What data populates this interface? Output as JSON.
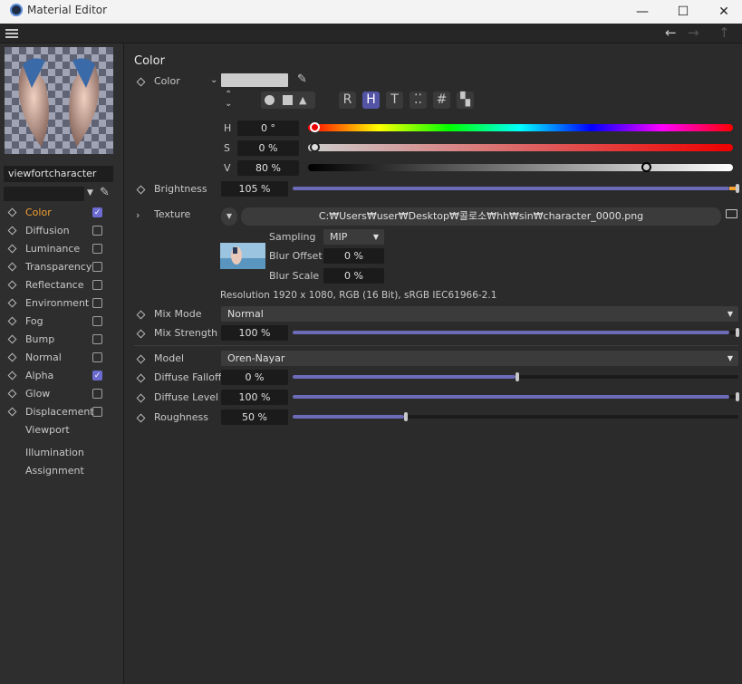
{
  "window": {
    "title": "Material Editor"
  },
  "sidebar": {
    "material_name": "viewfortcharacter",
    "channels": [
      {
        "label": "Color",
        "checked": true,
        "active": true
      },
      {
        "label": "Diffusion",
        "checked": false
      },
      {
        "label": "Luminance",
        "checked": false
      },
      {
        "label": "Transparency",
        "checked": false
      },
      {
        "label": "Reflectance",
        "checked": false
      },
      {
        "label": "Environment",
        "checked": false
      },
      {
        "label": "Fog",
        "checked": false
      },
      {
        "label": "Bump",
        "checked": false
      },
      {
        "label": "Normal",
        "checked": false
      },
      {
        "label": "Alpha",
        "checked": true
      },
      {
        "label": "Glow",
        "checked": false
      },
      {
        "label": "Displacement",
        "checked": false
      }
    ],
    "extra": [
      "Viewport",
      "Illumination",
      "Assignment"
    ]
  },
  "main": {
    "section_title": "Color",
    "color_label": "Color",
    "swatch_color": "#cccccc",
    "mode_buttons": [
      "R",
      "H",
      "T",
      "⁚⁚",
      "#",
      "▚"
    ],
    "h": {
      "label": "H",
      "value": "0 °",
      "fraction": 0.0
    },
    "s": {
      "label": "S",
      "value": "0 %",
      "fraction": 0.0
    },
    "v": {
      "label": "V",
      "value": "80 %",
      "fraction": 0.8
    },
    "brightness": {
      "label": "Brightness",
      "value": "105 %",
      "fraction": 1.0
    },
    "texture": {
      "label": "Texture",
      "path": "C:₩Users₩user₩Desktop₩콜로소₩hh₩sin₩character_0000.png"
    },
    "sampling": {
      "label": "Sampling",
      "value": "MIP"
    },
    "blur_offset": {
      "label": "Blur Offset",
      "value": "0 %"
    },
    "blur_scale": {
      "label": "Blur Scale",
      "value": "0 %"
    },
    "resolution": "Resolution 1920 x 1080, RGB (16 Bit), sRGB IEC61966-2.1",
    "mix_mode": {
      "label": "Mix Mode",
      "value": "Normal"
    },
    "mix_strength": {
      "label": "Mix Strength",
      "value": "100 %",
      "fraction": 1.0
    },
    "model": {
      "label": "Model",
      "value": "Oren-Nayar"
    },
    "diffuse_falloff": {
      "label": "Diffuse Falloff",
      "value": "0 %",
      "fraction": 0.5
    },
    "diffuse_level": {
      "label": "Diffuse Level",
      "value": "100 %",
      "fraction": 1.0
    },
    "roughness": {
      "label": "Roughness",
      "value": "50 %",
      "fraction": 0.25
    }
  },
  "colors": {
    "accent": "#f2a131",
    "slider": "#6b6bb8",
    "selected": "#5454a6"
  }
}
